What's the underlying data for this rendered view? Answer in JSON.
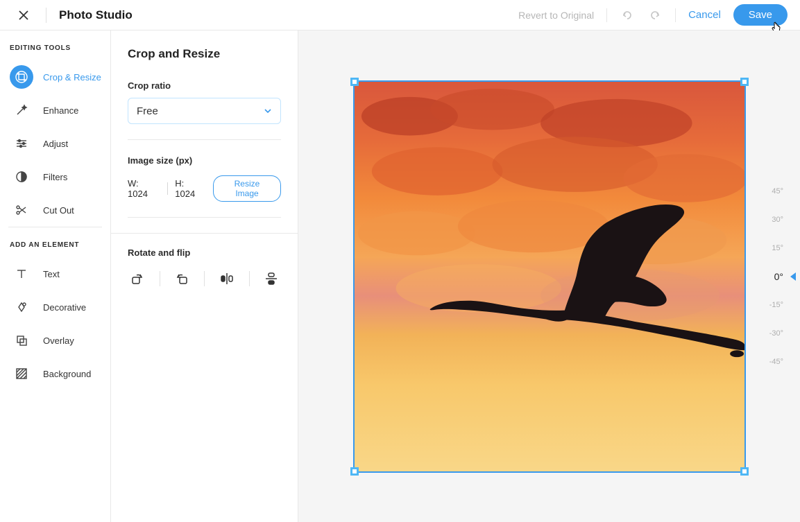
{
  "header": {
    "title": "Photo Studio",
    "revert": "Revert to Original",
    "cancel": "Cancel",
    "save": "Save"
  },
  "sidebar": {
    "editing_title": "EDITING TOOLS",
    "editing_items": [
      {
        "label": "Crop & Resize",
        "active": true
      },
      {
        "label": "Enhance",
        "active": false
      },
      {
        "label": "Adjust",
        "active": false
      },
      {
        "label": "Filters",
        "active": false
      },
      {
        "label": "Cut Out",
        "active": false
      }
    ],
    "add_title": "ADD AN ELEMENT",
    "add_items": [
      {
        "label": "Text"
      },
      {
        "label": "Decorative"
      },
      {
        "label": "Overlay"
      },
      {
        "label": "Background"
      }
    ]
  },
  "panel": {
    "title": "Crop and Resize",
    "crop_ratio_label": "Crop ratio",
    "crop_ratio_value": "Free",
    "image_size_label": "Image size (px)",
    "width_label": "W: 1024",
    "height_label": "H: 1024",
    "resize_button": "Resize Image",
    "rotate_label": "Rotate and flip"
  },
  "ruler": {
    "ticks": [
      "45°",
      "30°",
      "15°",
      "0°",
      "-15°",
      "-30°",
      "-45°"
    ],
    "active_index": 3
  }
}
